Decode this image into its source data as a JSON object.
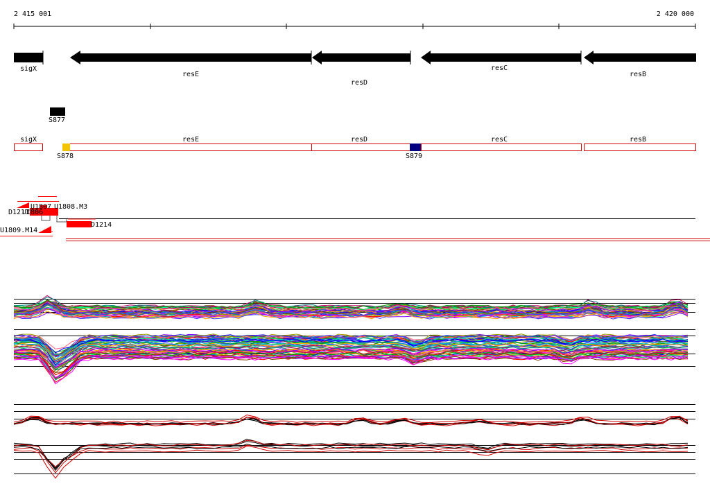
{
  "ruler": {
    "start_label": "2 415 001",
    "end_label": "2 420 000"
  },
  "genes": [
    {
      "name": "sigX",
      "strand": "-"
    },
    {
      "name": "resE",
      "strand": "-"
    },
    {
      "name": "resD",
      "strand": "-"
    },
    {
      "name": "resC",
      "strand": "-"
    },
    {
      "name": "resB",
      "strand": "-"
    }
  ],
  "sites": [
    {
      "label": "S877",
      "color": "#000000"
    },
    {
      "label": "S878",
      "color": "#f5c400"
    },
    {
      "label": "S879",
      "color": "#000080"
    }
  ],
  "cluster_labels": {
    "u1807": "U1807",
    "u1808": "U1808.M3",
    "d1211": "D1211",
    "u1806": "U1806",
    "d1214": "D1214",
    "u1809": "U1809.M14"
  },
  "colors": {
    "gene_fill": "#000000",
    "gene_outline": "#d00000",
    "feature_red": "#ff0000",
    "axis": "#000000"
  }
}
